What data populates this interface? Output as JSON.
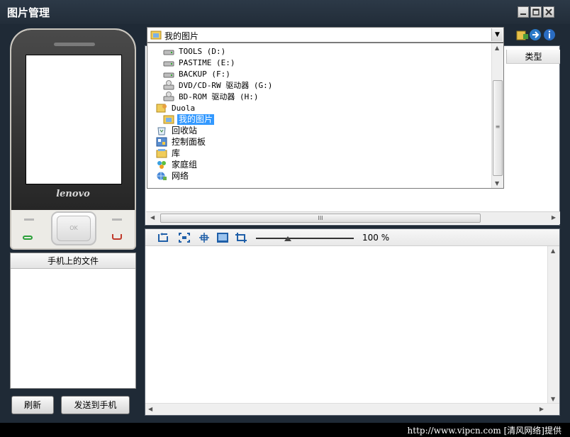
{
  "window": {
    "title": "图片管理",
    "controls": [
      "minimize-icon",
      "maximize-icon",
      "close-icon"
    ]
  },
  "phone": {
    "brand": "lenovo",
    "ok_label": "OK"
  },
  "phone_files": {
    "header": "手机上的文件",
    "items": []
  },
  "buttons": {
    "refresh": "刷新",
    "send_to_phone": "发送到手机"
  },
  "toolbar_icons": [
    "folder-icon",
    "go-icon",
    "info-icon"
  ],
  "location": {
    "selected": "我的图片"
  },
  "file_list": {
    "columns": [
      "类型"
    ],
    "scroll_glyph": "III"
  },
  "location_dropdown": [
    {
      "label": "TOOLS (D:)",
      "icon": "drive-icon",
      "depth": 1
    },
    {
      "label": "PASTIME (E:)",
      "icon": "drive-icon",
      "depth": 1
    },
    {
      "label": "BACKUP (F:)",
      "icon": "drive-icon",
      "depth": 1
    },
    {
      "label": "DVD/CD-RW 驱动器 (G:)",
      "icon": "cd-drive-icon",
      "depth": 1
    },
    {
      "label": "BD-ROM 驱动器 (H:)",
      "icon": "cd-drive-icon",
      "depth": 1
    },
    {
      "label": "Duola",
      "icon": "user-folder-icon",
      "depth": 0
    },
    {
      "label": "我的图片",
      "icon": "pictures-folder-icon",
      "depth": 1,
      "selected": true
    },
    {
      "label": "回收站",
      "icon": "recycle-bin-icon",
      "depth": 0
    },
    {
      "label": "控制面板",
      "icon": "control-panel-icon",
      "depth": 0
    },
    {
      "label": "库",
      "icon": "library-icon",
      "depth": 0
    },
    {
      "label": "家庭组",
      "icon": "homegroup-icon",
      "depth": 0
    },
    {
      "label": "网络",
      "icon": "network-icon",
      "depth": 0
    }
  ],
  "viewer": {
    "tools": [
      "rotate-icon",
      "fit-window-icon",
      "actual-size-icon",
      "fullscreen-icon",
      "crop-icon"
    ],
    "zoom": "100 %",
    "zoom_value": 100
  },
  "footer": {
    "credit": "http://www.vipcn.com [清风网络]提供"
  },
  "colors": {
    "background": "#1f2a36",
    "selection": "#3399ff"
  }
}
